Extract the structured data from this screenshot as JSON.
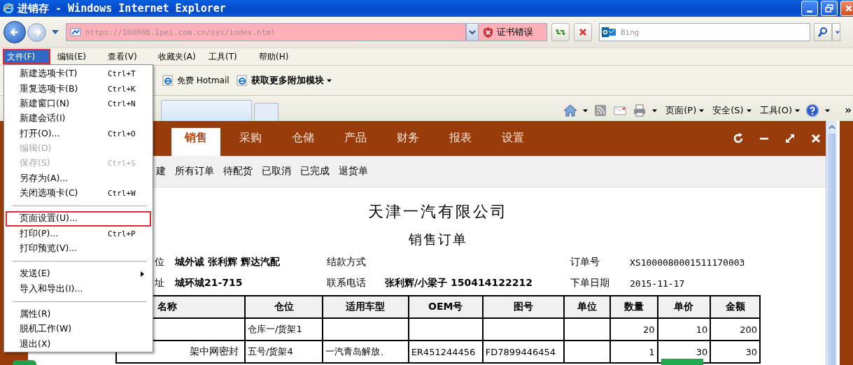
{
  "window": {
    "title": "进销存 - Windows Internet Explorer"
  },
  "address_bar": {
    "url": "https://100008.1pei.com.cn/sys/index.html",
    "certificate_error": "证书错误"
  },
  "search": {
    "placeholder": "Bing"
  },
  "menu_bar": [
    {
      "label": "文件(F)",
      "selected": true
    },
    {
      "label": "编辑(E)",
      "selected": false
    },
    {
      "label": "查看(V)",
      "selected": false
    },
    {
      "label": "收藏夹(A)",
      "selected": false
    },
    {
      "label": "工具(T)",
      "selected": false
    },
    {
      "label": "帮助(H)",
      "selected": false
    }
  ],
  "favorites_bar": [
    {
      "kind": "link",
      "label": "免费 Hotmail"
    },
    {
      "kind": "menu",
      "label": "获取更多附加模块"
    }
  ],
  "command_bar": [
    "页面(P)",
    "安全(S)",
    "工具(O)"
  ],
  "file_menu": [
    [
      {
        "label": "新建选项卡(T)",
        "shortcut": "Ctrl+T",
        "disabled": false,
        "highlighted": false,
        "submenu": false
      },
      {
        "label": "重复选项卡(B)",
        "shortcut": "Ctrl+K",
        "disabled": false,
        "highlighted": false,
        "submenu": false
      },
      {
        "label": "新建窗口(N)",
        "shortcut": "Ctrl+N",
        "disabled": false,
        "highlighted": false,
        "submenu": false
      },
      {
        "label": "新建会话(I)",
        "disabled": false,
        "highlighted": false,
        "submenu": false
      },
      {
        "label": "打开(O)...",
        "shortcut": "Ctrl+O",
        "disabled": false,
        "highlighted": false,
        "submenu": false
      },
      {
        "label": "编辑(D)",
        "disabled": true,
        "highlighted": false,
        "submenu": false
      },
      {
        "label": "保存(S)",
        "shortcut": "Ctrl+S",
        "disabled": true,
        "highlighted": false,
        "submenu": false
      },
      {
        "label": "另存为(A)...",
        "disabled": false,
        "highlighted": false,
        "submenu": false
      },
      {
        "label": "关闭选项卡(C)",
        "shortcut": "Ctrl+W",
        "disabled": false,
        "highlighted": false,
        "submenu": false
      }
    ],
    [
      {
        "label": "页面设置(U)...",
        "disabled": false,
        "highlighted": true,
        "submenu": false
      },
      {
        "label": "打印(P)...",
        "shortcut": "Ctrl+P",
        "disabled": false,
        "highlighted": false,
        "submenu": false
      },
      {
        "label": "打印预览(V)...",
        "disabled": false,
        "highlighted": false,
        "submenu": false
      }
    ],
    [
      {
        "label": "发送(E)",
        "disabled": false,
        "highlighted": false,
        "submenu": true
      },
      {
        "label": "导入和导出(I)...",
        "disabled": false,
        "highlighted": false,
        "submenu": false
      }
    ],
    [
      {
        "label": "属性(R)",
        "disabled": false,
        "highlighted": false,
        "submenu": false
      },
      {
        "label": "脱机工作(W)",
        "disabled": false,
        "highlighted": false,
        "submenu": false
      },
      {
        "label": "退出(X)",
        "disabled": false,
        "highlighted": false,
        "submenu": false
      }
    ]
  ],
  "app": {
    "nav": [
      {
        "label": "销售",
        "selected": true
      },
      {
        "label": "采购",
        "selected": false
      },
      {
        "label": "仓储",
        "selected": false
      },
      {
        "label": "产品",
        "selected": false
      },
      {
        "label": "财务",
        "selected": false
      },
      {
        "label": "报表",
        "selected": false
      },
      {
        "label": "设置",
        "selected": false
      }
    ],
    "subnav": [
      "建",
      "所有订单",
      "待配货",
      "已取消",
      "已完成",
      "退货单"
    ],
    "document": {
      "company": "天津一汽有限公司",
      "title": "销售订单",
      "info": [
        [
          {
            "label": "位",
            "value": "城外诚 张利辉 辉达汽配"
          },
          {
            "label": "结款方式"
          },
          {
            "label": "订单号",
            "value": "XS1000080001511170003"
          }
        ],
        [
          {
            "label": "址",
            "value": "城环城21-715"
          },
          {
            "label": "联系电话",
            "value": "张利辉/小梁子 150414122212"
          },
          {
            "label": "下单日期",
            "value": "2015-11-17"
          }
        ]
      ],
      "table": {
        "columns": [
          "名称",
          "仓位",
          "适用车型",
          "OEM号",
          "图号",
          "单位",
          "数量",
          "单价",
          "金额"
        ],
        "rows": [
          [
            null,
            "仓库一/货架1",
            null,
            null,
            null,
            null,
            "20",
            "10",
            "200"
          ],
          [
            "架中网密封",
            "五号/货架4",
            "一汽青岛解放、",
            "ER451244456",
            "FD7899446454",
            null,
            "1",
            "30",
            "30"
          ]
        ]
      }
    }
  }
}
